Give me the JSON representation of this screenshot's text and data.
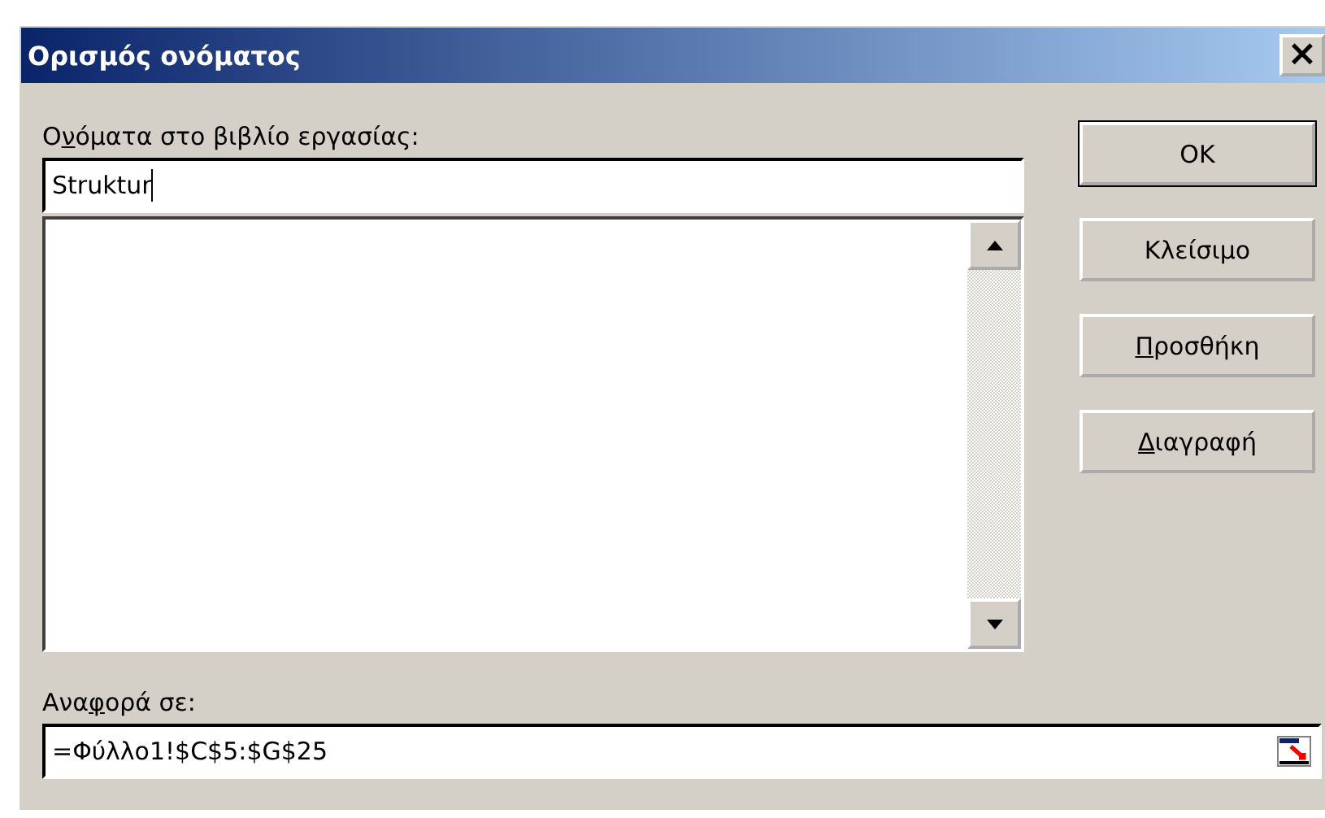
{
  "window": {
    "title": "Ορισμός ονόματος",
    "close": "×"
  },
  "names_label": {
    "before": "Ο",
    "mnemonic": "ν",
    "after": "όματα στο βιβλίο εργασίας:"
  },
  "name_field": {
    "value": "Struktur"
  },
  "buttons": [
    {
      "after": "OK",
      "default": true
    },
    {
      "after": "Κλείσιμο",
      "default": false
    },
    {
      "mnemonic": "Π",
      "after": "ροσθήκη",
      "default": false
    },
    {
      "mnemonic": "Δ",
      "after": "ιαγραφή",
      "default": false
    }
  ],
  "refers_label": {
    "before": "Ανα",
    "mnemonic": "φ",
    "after": "ορά σε:"
  },
  "refers_field": {
    "value": "=Φύλλο1!$C$5:$G$25"
  }
}
